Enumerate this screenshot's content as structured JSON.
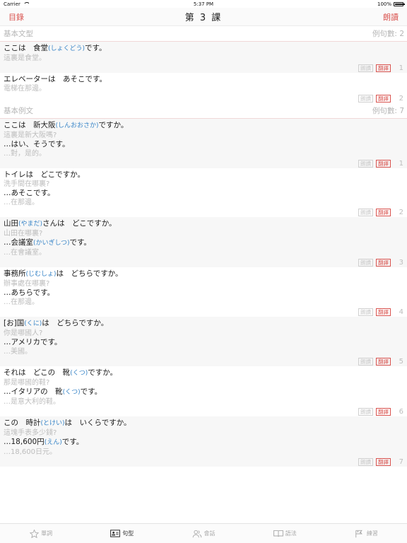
{
  "status": {
    "carrier": "Carrier",
    "time": "5:37 PM",
    "battery": "100%",
    "battery_level": 1.0
  },
  "nav": {
    "back": "目錄",
    "title": "第 3 課",
    "action": "朗讀"
  },
  "labels": {
    "read": "朗讀",
    "translate": "翻譯"
  },
  "sections": [
    {
      "title": "基本文型",
      "count": "例句數: 2",
      "entries": [
        {
          "num": "1",
          "lines": [
            {
              "jp": [
                [
                  "ここは　食堂",
                  ""
                ],
                [
                  "(しょくどう)",
                  "ruby"
                ],
                [
                  "です。",
                  ""
                ]
              ],
              "zh": "這裏是食堂。"
            }
          ]
        },
        {
          "num": "2",
          "lines": [
            {
              "jp": [
                [
                  "エレベーターは　あそこです。",
                  ""
                ]
              ],
              "zh": "電梯在那邊。"
            }
          ]
        }
      ]
    },
    {
      "title": "基本例文",
      "count": "例句數: 7",
      "entries": [
        {
          "num": "1",
          "lines": [
            {
              "jp": [
                [
                  "ここは　新大阪",
                  ""
                ],
                [
                  "(しんおおさか)",
                  "ruby"
                ],
                [
                  "ですか。",
                  ""
                ]
              ],
              "zh": "這裏是新大阪嗎?"
            },
            {
              "jp": [
                [
                  "…はい、そうです。",
                  ""
                ]
              ],
              "zh": "…對，是的。"
            }
          ]
        },
        {
          "num": "2",
          "lines": [
            {
              "jp": [
                [
                  "トイレは　どこですか。",
                  ""
                ]
              ],
              "zh": "洗手間在哪裏?"
            },
            {
              "jp": [
                [
                  "…あそこです。",
                  ""
                ]
              ],
              "zh": "…在那邊。"
            }
          ]
        },
        {
          "num": "3",
          "lines": [
            {
              "jp": [
                [
                  "山田",
                  ""
                ],
                [
                  "(やまだ)",
                  "ruby"
                ],
                [
                  "さんは　どこですか。",
                  ""
                ]
              ],
              "zh": "山田在哪裏?"
            },
            {
              "jp": [
                [
                  "…会議室",
                  ""
                ],
                [
                  "(かいぎしつ)",
                  "ruby"
                ],
                [
                  "です。",
                  ""
                ]
              ],
              "zh": "…在會議室。"
            }
          ]
        },
        {
          "num": "4",
          "lines": [
            {
              "jp": [
                [
                  "事務所",
                  ""
                ],
                [
                  "(じむしょ)",
                  "ruby"
                ],
                [
                  "は　どちらですか。",
                  ""
                ]
              ],
              "zh": "辦事處在哪裏?"
            },
            {
              "jp": [
                [
                  "…あちらです。",
                  ""
                ]
              ],
              "zh": "…在那邊。"
            }
          ]
        },
        {
          "num": "5",
          "lines": [
            {
              "jp": [
                [
                  "[お]国",
                  ""
                ],
                [
                  "(くに)",
                  "ruby"
                ],
                [
                  "は　どちらですか。",
                  ""
                ]
              ],
              "zh": "你是哪國人?"
            },
            {
              "jp": [
                [
                  "…アメリカです。",
                  ""
                ]
              ],
              "zh": "…美國。"
            }
          ]
        },
        {
          "num": "6",
          "lines": [
            {
              "jp": [
                [
                  "それは　どこの　靴",
                  ""
                ],
                [
                  "(くつ)",
                  "ruby"
                ],
                [
                  "ですか。",
                  ""
                ]
              ],
              "zh": "那是哪國的鞋?"
            },
            {
              "jp": [
                [
                  "…イタリアの　靴",
                  ""
                ],
                [
                  "(くつ)",
                  "ruby"
                ],
                [
                  "です。",
                  ""
                ]
              ],
              "zh": "…是意大利的鞋。"
            }
          ]
        },
        {
          "num": "7",
          "lines": [
            {
              "jp": [
                [
                  "この　時計",
                  ""
                ],
                [
                  "(とけい)",
                  "ruby"
                ],
                [
                  "は　いくらですか。",
                  ""
                ]
              ],
              "zh": "這塊手表多少錢?"
            },
            {
              "jp": [
                [
                  "…18,600円",
                  ""
                ],
                [
                  "(えん)",
                  "ruby"
                ],
                [
                  "です。",
                  ""
                ]
              ],
              "zh": "…18,600日元。"
            }
          ]
        }
      ]
    }
  ],
  "tabs": [
    {
      "label": "單詞",
      "icon": "star-icon",
      "active": false
    },
    {
      "label": "句型",
      "icon": "id-card-icon",
      "active": true
    },
    {
      "label": "會話",
      "icon": "people-icon",
      "active": false
    },
    {
      "label": "語法",
      "icon": "book-icon",
      "active": false
    },
    {
      "label": "練習",
      "icon": "flag-icon",
      "active": false
    }
  ],
  "colors": {
    "accent": "#d9534f",
    "ruby": "#3a86c8",
    "muted": "#bdbdbd"
  }
}
